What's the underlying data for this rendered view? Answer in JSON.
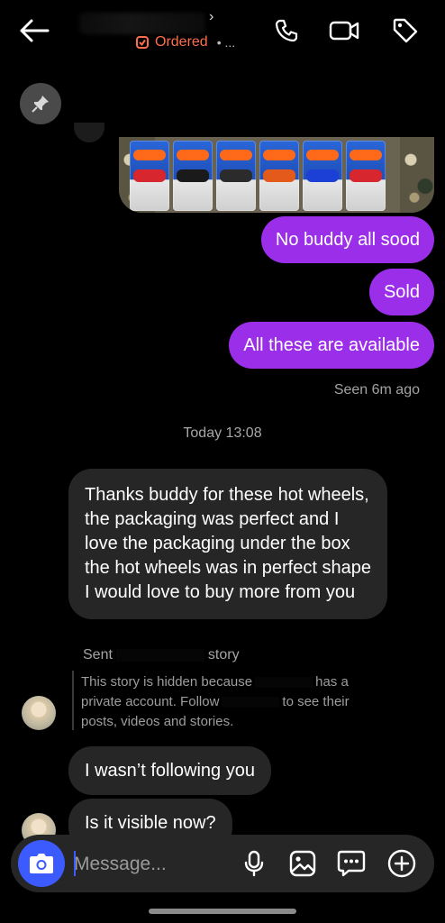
{
  "header": {
    "ordered_label": "Ordered",
    "ordered_suffix": "• ...",
    "chevron": "›",
    "icons": [
      "back-arrow-icon",
      "phone-icon",
      "video-camera-icon",
      "tag-icon"
    ]
  },
  "pinned": {
    "icon": "pin-icon"
  },
  "messages_sent": [
    {
      "text": "No buddy all sood"
    },
    {
      "text": "Sold"
    },
    {
      "text": "All these are available"
    }
  ],
  "seen_status": "Seen 6m ago",
  "timestamp": "Today 13:08",
  "messages_received": [
    {
      "text": "Thanks buddy for these hot wheels, the packaging was perfect and I love the packaging under the box the hot wheels was in perfect shape I would love to buy more from you"
    },
    {
      "text": "I wasn’t following you"
    },
    {
      "text": "Is it visible now?"
    }
  ],
  "story": {
    "sent_prefix": "Sent",
    "sent_suffix": "story",
    "line1_a": "This story is hidden because",
    "line1_b": "has a",
    "line2_a": "private account. Follow",
    "line2_b": "to see their",
    "line3": "posts, videos and stories."
  },
  "composer": {
    "placeholder": "Message...",
    "icons": [
      "camera-icon",
      "microphone-icon",
      "gallery-icon",
      "sticker-chat-icon",
      "add-icon"
    ]
  },
  "colors": {
    "accent": "#9b2ee8",
    "camera": "#3c5bff",
    "ordered": "#ff6e4a"
  }
}
